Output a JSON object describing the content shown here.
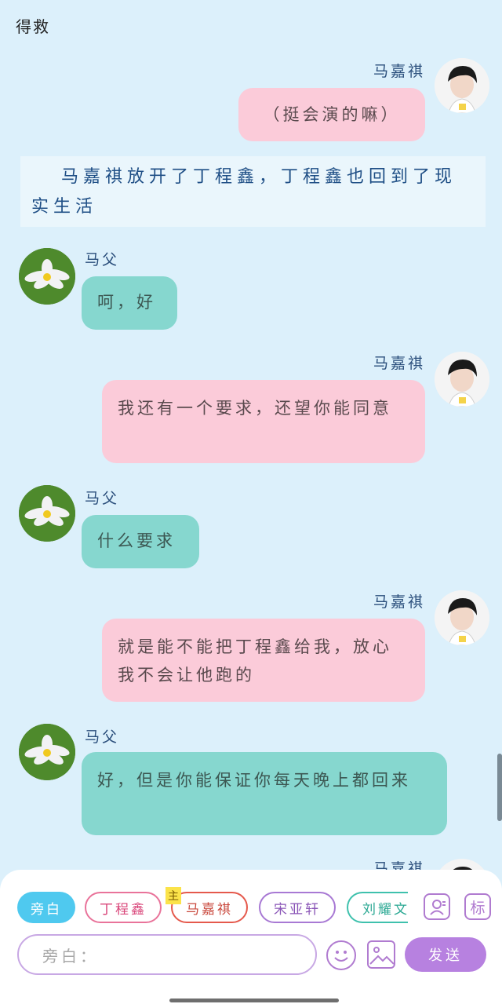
{
  "header": {
    "title": "得救"
  },
  "messages": [
    {
      "kind": "right",
      "name": "马嘉祺",
      "text": "（挺会演的嘛）"
    },
    {
      "kind": "narration",
      "text": "马嘉祺放开了丁程鑫，丁程鑫也回到了现实生活"
    },
    {
      "kind": "left",
      "name": "马父",
      "text": "呵，好"
    },
    {
      "kind": "right",
      "name": "马嘉祺",
      "text": "我还有一个要求，还望你能同意"
    },
    {
      "kind": "left",
      "name": "马父",
      "text": "什么要求"
    },
    {
      "kind": "right",
      "name": "马嘉祺",
      "text": "就是能不能把丁程鑫给我，放心我不会让他跑的"
    },
    {
      "kind": "left",
      "name": "马父",
      "text": "好，但是你能保证你每天晚上都回来"
    },
    {
      "kind": "right",
      "name": "马嘉祺",
      "text": ""
    }
  ],
  "roles": {
    "narration": "旁白",
    "ding": "丁程鑫",
    "ma": "马嘉祺",
    "song": "宋亚轩",
    "liu": "刘耀文",
    "main_badge": "主"
  },
  "toolbar": {
    "mark_label": "标",
    "input_placeholder": "旁白：",
    "send_label": "发送"
  },
  "colors": {
    "background": "#dcf0fb",
    "right_bubble": "#fbcbd9",
    "left_bubble": "#86d7cf",
    "narration_bg": "#eaf6fc",
    "send_button": "#b781e0"
  },
  "icons": [
    "person-card-icon",
    "mark-icon",
    "emoji-icon",
    "image-icon"
  ]
}
